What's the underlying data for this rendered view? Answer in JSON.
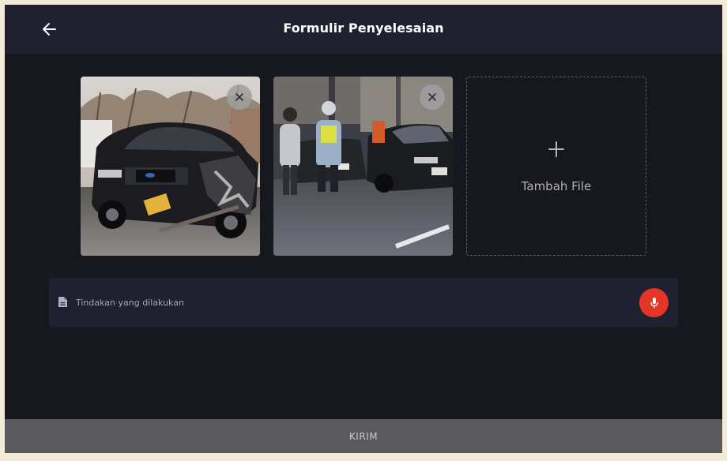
{
  "header": {
    "title": "Formulir Penyelesaian",
    "back_icon": "arrow-left-icon"
  },
  "attachments": {
    "photos": [
      {
        "remove_icon": "close-icon",
        "image": "photo-wrecked-police-car"
      },
      {
        "remove_icon": "close-icon",
        "image": "photo-traffic-accident-scene"
      }
    ],
    "add_file": {
      "icon": "plus-icon",
      "label": "Tambah File"
    }
  },
  "action_field": {
    "icon": "document-icon",
    "placeholder": "Tindakan yang dilakukan",
    "value": "",
    "mic_icon": "microphone-icon"
  },
  "submit": {
    "label": "KIRIM"
  },
  "colors": {
    "background": "#17171e",
    "appbar": "#1f2130",
    "mic_button": "#e53527",
    "submit_bar": "#5a5a5e"
  }
}
